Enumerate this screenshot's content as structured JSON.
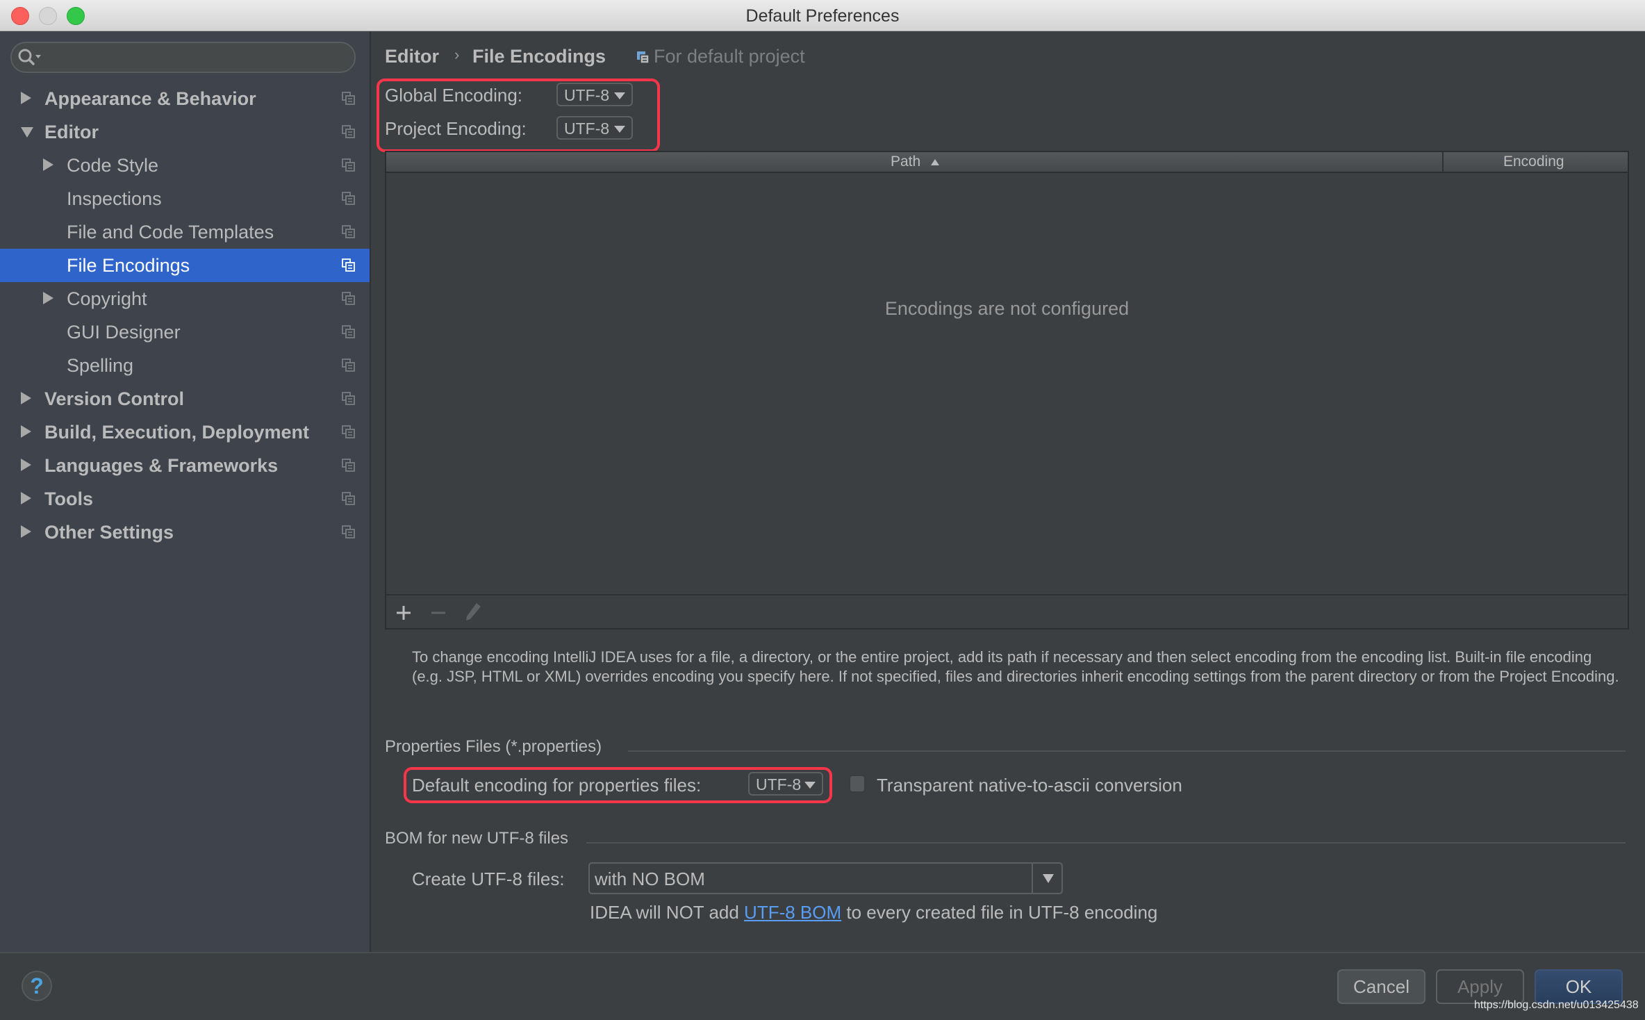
{
  "window": {
    "title": "Default Preferences",
    "controls": [
      "close",
      "minimize",
      "zoom"
    ]
  },
  "sidebar": {
    "search": {
      "placeholder": "",
      "value": "",
      "icon": "search-icon"
    },
    "items": [
      {
        "label": "Appearance & Behavior",
        "level": 0,
        "bold": true,
        "expander": "collapsed"
      },
      {
        "label": "Editor",
        "level": 0,
        "bold": true,
        "expander": "expanded"
      },
      {
        "label": "Code Style",
        "level": 1,
        "bold": false,
        "expander": "collapsed"
      },
      {
        "label": "Inspections",
        "level": 1,
        "bold": false,
        "expander": "none"
      },
      {
        "label": "File and Code Templates",
        "level": 1,
        "bold": false,
        "expander": "none"
      },
      {
        "label": "File Encodings",
        "level": 1,
        "bold": false,
        "expander": "none",
        "selected": true
      },
      {
        "label": "Copyright",
        "level": 1,
        "bold": false,
        "expander": "collapsed"
      },
      {
        "label": "GUI Designer",
        "level": 1,
        "bold": false,
        "expander": "none"
      },
      {
        "label": "Spelling",
        "level": 1,
        "bold": false,
        "expander": "none"
      },
      {
        "label": "Version Control",
        "level": 0,
        "bold": true,
        "expander": "collapsed"
      },
      {
        "label": "Build, Execution, Deployment",
        "level": 0,
        "bold": true,
        "expander": "collapsed"
      },
      {
        "label": "Languages & Frameworks",
        "level": 0,
        "bold": true,
        "expander": "collapsed"
      },
      {
        "label": "Tools",
        "level": 0,
        "bold": true,
        "expander": "collapsed"
      },
      {
        "label": "Other Settings",
        "level": 0,
        "bold": true,
        "expander": "collapsed"
      }
    ]
  },
  "breadcrumb": {
    "parent": "Editor",
    "separator": "›",
    "current": "File Encodings",
    "scope_note": "For default project"
  },
  "encodings": {
    "global_label": "Global Encoding:",
    "global_value": "UTF-8",
    "project_label": "Project Encoding:",
    "project_value": "UTF-8"
  },
  "table": {
    "columns": [
      {
        "label": "Path",
        "sort": "ascending"
      },
      {
        "label": "Encoding"
      }
    ],
    "rows": [],
    "empty_text": "Encodings are not configured",
    "toolbar": {
      "add": "+",
      "remove": "−",
      "edit": "edit"
    }
  },
  "description": "To change encoding IntelliJ IDEA uses for a file, a directory, or the entire project, add its path if necessary and then select encoding from the encoding list. Built-in file encoding (e.g. JSP, HTML or XML) overrides encoding you specify here. If not specified, files and directories inherit encoding settings from the parent directory or from the Project Encoding.",
  "properties": {
    "section_title": "Properties Files (*.properties)",
    "default_label": "Default encoding for properties files:",
    "default_value": "UTF-8",
    "transparent_label": "Transparent native-to-ascii conversion",
    "transparent_checked": false
  },
  "bom": {
    "section_title": "BOM for new UTF-8 files",
    "create_label": "Create UTF-8 files:",
    "create_value": "with NO BOM",
    "info_prefix": "IDEA will NOT add ",
    "info_link": "UTF-8 BOM",
    "info_suffix": " to every created file in UTF-8 encoding"
  },
  "footer": {
    "help": "?",
    "cancel": "Cancel",
    "apply": "Apply",
    "ok": "OK",
    "watermark": "https://blog.csdn.net/u013425438"
  },
  "colors": {
    "selection": "#2f65ca",
    "highlight_box": "#f5364a",
    "link": "#589df6",
    "ok_button": "#2d4566"
  }
}
